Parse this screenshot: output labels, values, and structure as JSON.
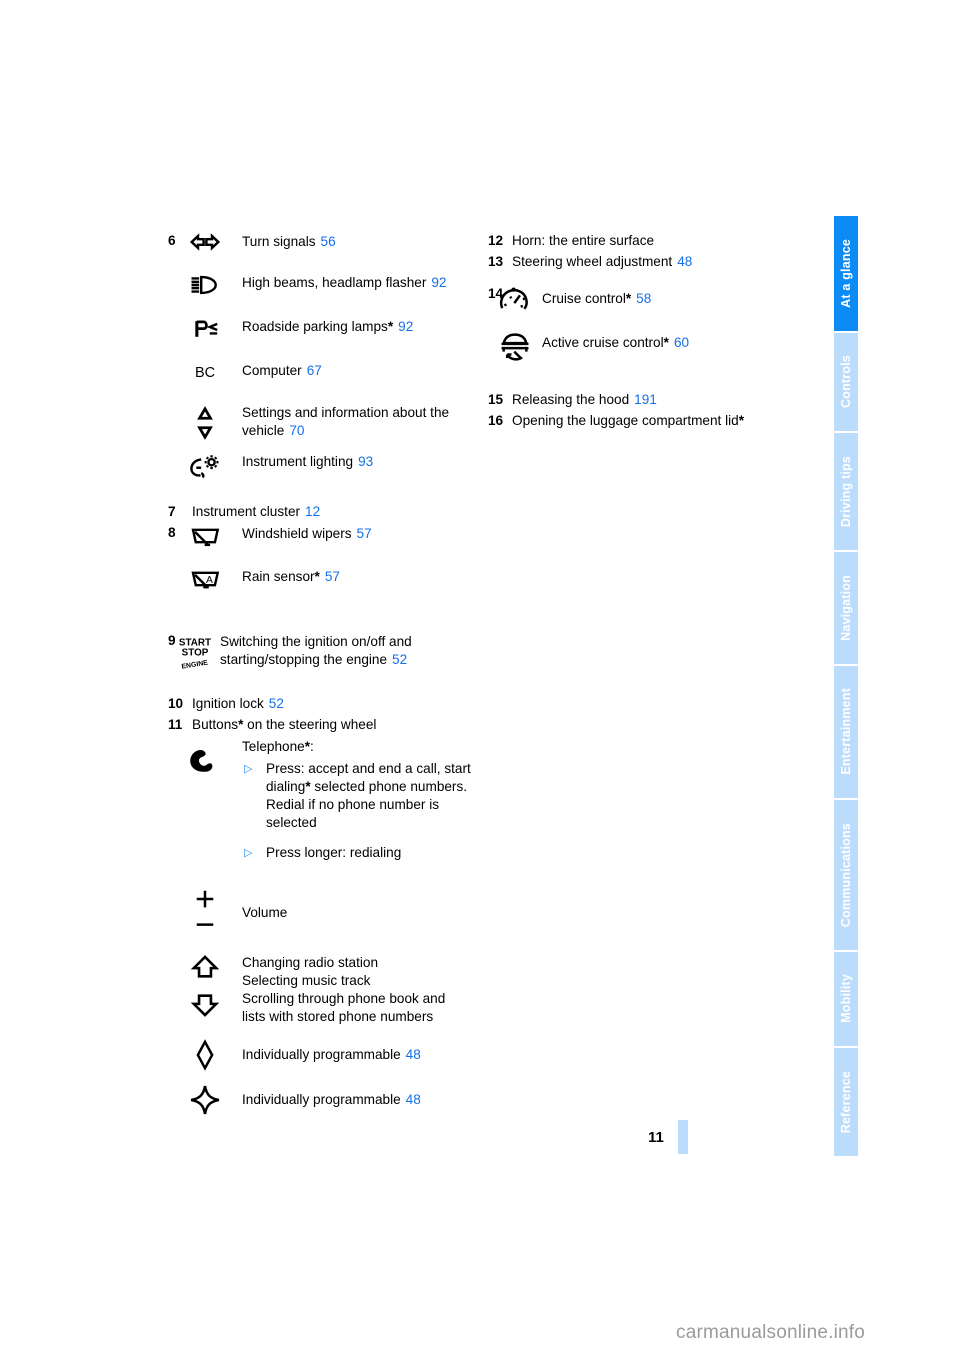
{
  "page": {
    "folio": "11",
    "watermark": "carmanualsonline.info"
  },
  "tabs": [
    {
      "label": "At a glance",
      "active": true
    },
    {
      "label": "Controls",
      "active": false
    },
    {
      "label": "Driving tips",
      "active": false
    },
    {
      "label": "Navigation",
      "active": false
    },
    {
      "label": "Entertainment",
      "active": false
    },
    {
      "label": "Communications",
      "active": false
    },
    {
      "label": "Mobility",
      "active": false
    },
    {
      "label": "Reference",
      "active": false
    }
  ],
  "colors": {
    "link": "#1570e6",
    "tab_active": "#0c8bf5",
    "tab_inactive": "#bcdcfb",
    "bullet": "#1f8bf7",
    "watermark": "#9b9b9b"
  },
  "left_column": {
    "item6": {
      "number": "6",
      "entries": [
        {
          "icon": "turn-signals-icon",
          "label": "Turn signals",
          "page": "56"
        },
        {
          "icon": "high-beam-icon",
          "label": "High beams, headlamp flasher",
          "page": "92"
        },
        {
          "icon": "parking-lamps-icon",
          "label": "Roadside parking lamps",
          "star": "*",
          "page": "92"
        },
        {
          "icon": "board-computer-icon",
          "label": "Computer",
          "page": "67"
        },
        {
          "icon": "up-down-triangles-icon",
          "label": "Settings and information about the vehicle",
          "page": "70"
        },
        {
          "icon": "instrument-lighting-icon",
          "label": "Instrument lighting",
          "page": "93"
        }
      ]
    },
    "item7": {
      "number": "7",
      "label": "Instrument cluster",
      "page": "12"
    },
    "item8": {
      "number": "8",
      "entries": [
        {
          "icon": "windshield-wiper-icon",
          "label": "Windshield wipers",
          "page": "57"
        },
        {
          "icon": "rain-sensor-icon",
          "label": "Rain sensor",
          "star": "*",
          "page": "57"
        }
      ]
    },
    "item9": {
      "number": "9",
      "icon": "start-stop-engine-icon",
      "label": "Switching the ignition on/off and starting/stopping the engine",
      "page": "52"
    },
    "item10": {
      "number": "10",
      "label": "Ignition lock",
      "page": "52"
    },
    "item11": {
      "number": "11",
      "label_prefix": "Buttons",
      "star": "*",
      "label_suffix": " on the steering wheel",
      "telephone": {
        "icon": "telephone-handset-icon",
        "label": "Telephone",
        "star": "*",
        "colon": ":",
        "bullets": [
          {
            "marker": "▷",
            "text_parts": [
              "Press: accept and end a call, start dialing",
              "*",
              " selected phone numbers. Redial if no phone number is selected"
            ]
          },
          {
            "marker": "▷",
            "text": "Press longer: redialing"
          }
        ]
      },
      "volume": {
        "icon": "plus-minus-volume-icon",
        "label": "Volume"
      },
      "arrows": {
        "icon_up": "arrow-up-outline-icon",
        "icon_down": "arrow-down-outline-icon",
        "lines": [
          "Changing radio station",
          "Selecting music track",
          "Scrolling through phone book and",
          "lists with stored phone numbers"
        ]
      },
      "programmable": [
        {
          "icon": "diamond-icon",
          "label": "Individually programmable",
          "page": "48"
        },
        {
          "icon": "star-four-point-icon",
          "label": "Individually programmable",
          "page": "48"
        }
      ]
    }
  },
  "right_column": {
    "item12": {
      "number": "12",
      "label": "Horn: the entire surface"
    },
    "item13": {
      "number": "13",
      "label": "Steering wheel adjustment",
      "page": "48"
    },
    "item14": {
      "number": "14",
      "entries": [
        {
          "icon": "cruise-control-icon",
          "label": "Cruise control",
          "star": "*",
          "page": "58"
        },
        {
          "icon": "active-cruise-control-icon",
          "label": "Active cruise control",
          "star": "*",
          "page": "60"
        }
      ]
    },
    "item15": {
      "number": "15",
      "label": "Releasing the hood",
      "page": "191"
    },
    "item16": {
      "number": "16",
      "label": "Opening the luggage compartment lid",
      "star": "*"
    }
  }
}
